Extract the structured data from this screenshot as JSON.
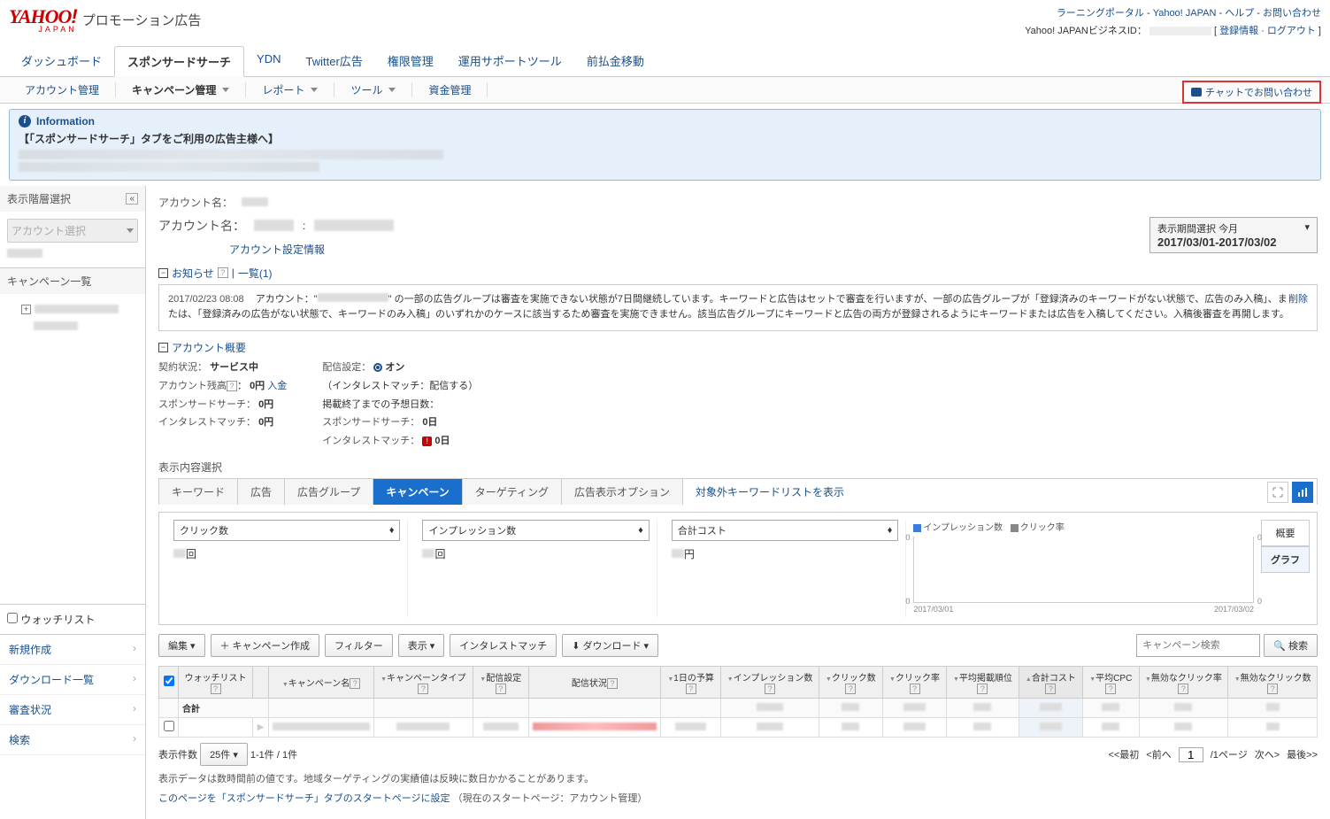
{
  "header": {
    "logo_sub": "プロモーション広告",
    "links": {
      "portal": "ラーニングポータル",
      "yjp": "Yahoo! JAPAN",
      "help": "ヘルプ",
      "contact": "お問い合わせ"
    },
    "biz_id_label": "Yahoo! JAPANビジネスID：",
    "reg_info": "登録情報",
    "logout": "ログアウト"
  },
  "tabs": [
    "ダッシュボード",
    "スポンサードサーチ",
    "YDN",
    "Twitter広告",
    "権限管理",
    "運用サポートツール",
    "前払金移動"
  ],
  "subnav": [
    "アカウント管理",
    "キャンペーン管理",
    "レポート",
    "ツール",
    "資金管理"
  ],
  "chat_btn": "チャットでお問い合わせ",
  "info": {
    "title": "Information",
    "subtitle": "【「スポンサードサーチ」タブをご利用の広告主様へ】"
  },
  "sidebar": {
    "layer_sel": "表示階層選択",
    "acct_sel": "アカウント選択",
    "campaign_list": "キャンペーン一覧",
    "watchlist": "ウォッチリスト",
    "links": [
      "新規作成",
      "ダウンロード一覧",
      "審査状況",
      "検索"
    ]
  },
  "account": {
    "name_label": "アカウント名：",
    "settings_link": "アカウント設定情報",
    "period_label": "表示期間選択",
    "period_preset": "今月",
    "period_value": "2017/03/01-2017/03/02"
  },
  "notice": {
    "head": "お知らせ",
    "list_link": "一覧(1)",
    "date": "2017/02/23 08:08",
    "prefix": "アカウント：\"",
    "body": "の一部の広告グループは審査を実施できない状態が7日間継続しています。キーワードと広告はセットで審査を行いますが、一部の広告グループが「登録済みのキーワードがない状態で、広告のみ入稿」、または、「登録済みの広告がない状態で、キーワードのみ入稿」のいずれかのケースに該当するため審査を実施できません。該当広告グループにキーワードと広告の両方が登録されるようにキーワードまたは広告を入稿してください。入稿後審査を再開します。",
    "delete": "削除"
  },
  "overview": {
    "head": "アカウント概要",
    "contract": "契約状況：",
    "contract_v": "サービス中",
    "balance": "アカウント残高",
    "balance_v": "0円",
    "deposit": "入金",
    "ss": "スポンサードサーチ：",
    "ss_v": "0円",
    "im": "インタレストマッチ：",
    "im_v": "0円",
    "delivery": "配信設定：",
    "delivery_v": "オン",
    "im_note": "（インタレストマッチ：配信する）",
    "days_label": "掲載終了までの予想日数：",
    "ss_days": "スポンサードサーチ：",
    "ss_days_v": "0日",
    "im_days": "インタレストマッチ：",
    "im_days_v": "0日"
  },
  "content_sel": "表示内容選択",
  "ctabs": [
    "キーワード",
    "広告",
    "広告グループ",
    "キャンペーン",
    "ターゲティング",
    "広告表示オプション"
  ],
  "neg_kw": "対象外キーワードリストを表示",
  "metrics": [
    "クリック数",
    "インプレッション数",
    "合計コスト"
  ],
  "metric_unit": [
    "回",
    "回",
    "円"
  ],
  "legend": {
    "imp": "インプレッション数",
    "ctr": "クリック率"
  },
  "chart_data": {
    "type": "line",
    "x": [
      "2017/03/01",
      "2017/03/02"
    ],
    "series": [
      {
        "name": "インプレッション数",
        "values": [
          0,
          0
        ],
        "color": "#3b7dd8"
      },
      {
        "name": "クリック率",
        "values": [
          0,
          0
        ],
        "color": "#888"
      }
    ],
    "yleft": 0,
    "yright": 0
  },
  "side_tabs": [
    "概要",
    "グラフ"
  ],
  "toolbar": {
    "edit": "編集",
    "create": "キャンペーン作成",
    "filter": "フィルター",
    "display": "表示",
    "im": "インタレストマッチ",
    "download": "ダウンロード",
    "search_ph": "キャンペーン検索",
    "search": "検索"
  },
  "columns": [
    "",
    "ウォッチリスト",
    "",
    "キャンペーン名",
    "キャンペーンタイプ",
    "配信設定",
    "配信状況",
    "1日の予算",
    "インプレッション数",
    "クリック数",
    "クリック率",
    "平均掲載順位",
    "合計コスト",
    "平均CPC",
    "無効なクリック率",
    "無効なクリック数"
  ],
  "total_label": "合計",
  "pager": {
    "rows_label": "表示件数",
    "rows": "25件",
    "info": "1-1件 / 1件",
    "first": "<<最初",
    "prev": "<前へ",
    "page": "1",
    "total": "/1ページ",
    "next": "次へ>",
    "last": "最後>>"
  },
  "footer1": "表示データは数時間前の値です。地域ターゲティングの実績値は反映に数日かかることがあります。",
  "footer2_a": "このページを「スポンサードサーチ」タブのスタートページに設定",
  "footer2_b": "（現在のスタートページ：アカウント管理）"
}
